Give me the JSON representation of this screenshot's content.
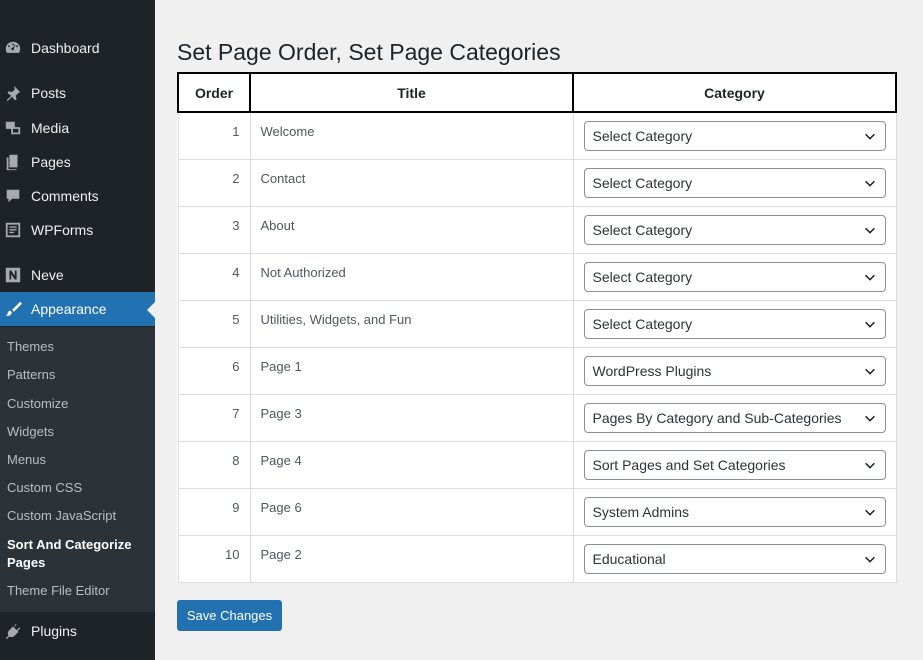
{
  "sidebar": {
    "items": [
      {
        "label": "Dashboard",
        "icon": "dashboard-icon"
      },
      {
        "label": "Posts",
        "icon": "pin-icon"
      },
      {
        "label": "Media",
        "icon": "media-icon"
      },
      {
        "label": "Pages",
        "icon": "pages-icon"
      },
      {
        "label": "Comments",
        "icon": "comment-icon"
      },
      {
        "label": "WPForms",
        "icon": "forms-icon"
      },
      {
        "label": "Neve",
        "icon": "neve-icon"
      },
      {
        "label": "Appearance",
        "icon": "brush-icon"
      },
      {
        "label": "Plugins",
        "icon": "plugin-icon"
      }
    ],
    "submenu": [
      "Themes",
      "Patterns",
      "Customize",
      "Widgets",
      "Menus",
      "Custom CSS",
      "Custom JavaScript",
      "Sort And Categorize Pages",
      "Theme File Editor"
    ]
  },
  "main": {
    "title": "Set Page Order, Set Page Categories",
    "headers": {
      "order": "Order",
      "title": "Title",
      "category": "Category"
    },
    "rows": [
      {
        "order": "1",
        "title": "Welcome",
        "category": "Select Category"
      },
      {
        "order": "2",
        "title": "Contact",
        "category": "Select Category"
      },
      {
        "order": "3",
        "title": "About",
        "category": "Select Category"
      },
      {
        "order": "4",
        "title": "Not Authorized",
        "category": "Select Category"
      },
      {
        "order": "5",
        "title": "Utilities, Widgets, and Fun",
        "category": "Select Category"
      },
      {
        "order": "6",
        "title": "Page 1",
        "category": "WordPress Plugins"
      },
      {
        "order": "7",
        "title": "Page 3",
        "category": "Pages By Category and Sub-Categories"
      },
      {
        "order": "8",
        "title": "Page 4",
        "category": "Sort Pages and Set Categories"
      },
      {
        "order": "9",
        "title": "Page 6",
        "category": "System Admins"
      },
      {
        "order": "10",
        "title": "Page 2",
        "category": "Educational"
      }
    ],
    "save_label": "Save Changes"
  },
  "colors": {
    "accent": "#2271b1",
    "sidebar_bg": "#1d2327",
    "submenu_bg": "#2c3338",
    "page_bg": "#f0f0f1"
  }
}
